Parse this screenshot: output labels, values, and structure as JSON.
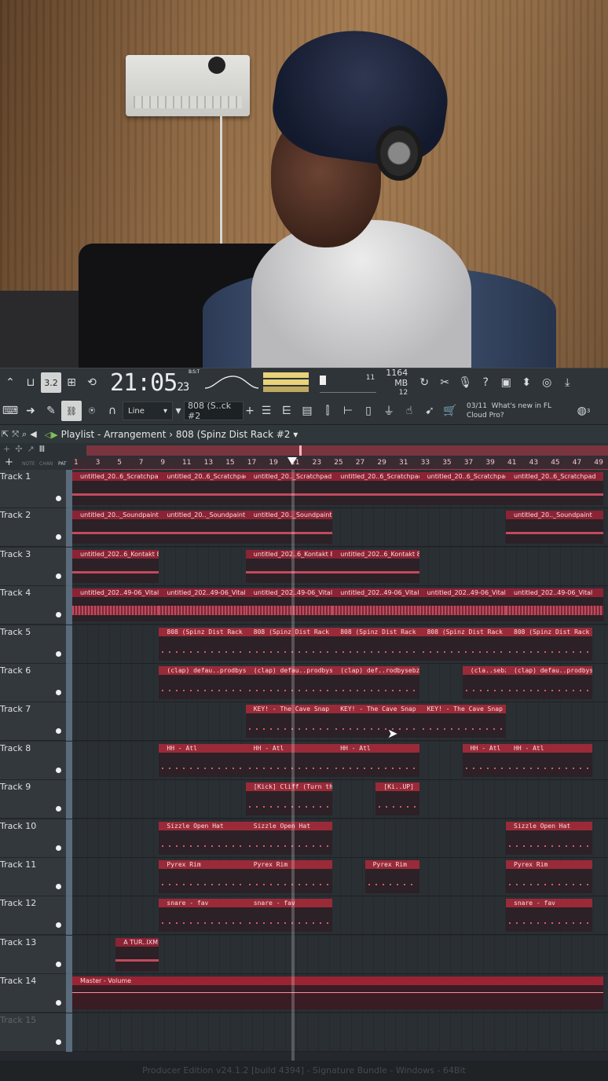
{
  "toolbar": {
    "tempo_display": "3.2",
    "clock": "21:05",
    "clock_small": "23",
    "clock_sup": "B:S:T",
    "cpu_value": "11",
    "memory_mb": "1164 MB",
    "polyphony": "12",
    "snap_mode": "Line",
    "pattern_name": "808 (S..ck #2",
    "news_date": "03/11",
    "news_text": "What's new in FL",
    "news_text2": "Cloud Pro?",
    "news_badge": "3"
  },
  "playlist": {
    "title": "Playlist - Arrangement",
    "separator": "›",
    "pattern": "808 (Spinz Dist Rack #2",
    "dropdown_arrow": "▾"
  },
  "ruler": {
    "bars": [
      "1",
      "3",
      "5",
      "7",
      "9",
      "11",
      "13",
      "15",
      "17",
      "19",
      "21",
      "23",
      "25",
      "27",
      "29",
      "31",
      "33",
      "35",
      "37",
      "39",
      "41",
      "43",
      "45",
      "47",
      "49"
    ],
    "left_labels": [
      "NOTE",
      "CHAN",
      "PAT"
    ]
  },
  "tracks": [
    {
      "name": "Track 1"
    },
    {
      "name": "Track 2"
    },
    {
      "name": "Track 3"
    },
    {
      "name": "Track 4"
    },
    {
      "name": "Track 5"
    },
    {
      "name": "Track 6"
    },
    {
      "name": "Track 7"
    },
    {
      "name": "Track 8"
    },
    {
      "name": "Track 9"
    },
    {
      "name": "Track 10"
    },
    {
      "name": "Track 11"
    },
    {
      "name": "Track 12"
    },
    {
      "name": "Track 13"
    },
    {
      "name": "Track 14"
    },
    {
      "name": "Track 15"
    }
  ],
  "clips": {
    "t1": [
      "untitled_20..6_Scratchpad",
      "untitled_20..6_Scratchpad",
      "untitled_20.._Scratchpad",
      "untitled_20..6_Scratchpad",
      "untitled_20..6_Scratchpad",
      "untitled_20..6_Scratchpad"
    ],
    "t2": [
      "untitled_20.._Soundpaint",
      "untitled_20.._Soundpaint",
      "untitled_20.._Soundpaint",
      "untitled_20.._Soundpaint"
    ],
    "t3": [
      "untitled_202..6_Kontakt 8",
      "untitled_202..6_Kontakt 8",
      "untitled_202..6_Kontakt 8"
    ],
    "t4": [
      "untitled_202..49-06_Vital",
      "untitled_202..49-06_Vital",
      "untitled_202..49-06_Vital",
      "untitled_202..49-06_Vital",
      "untitled_202..49-06_Vital",
      "untitled_202..49-06_Vital"
    ],
    "t5": [
      "808 (Spinz Dist Rack #2",
      "808 (Spinz Dist Rack",
      "808 (Spinz Dist Rack",
      "808 (Spinz Dist Rack",
      "808 (Spinz Dist Rack"
    ],
    "t6": [
      "(clap) defau..prodbysebzy",
      "(clap) defau..prodbysebzy",
      "(clap) def..rodbysebzy",
      "(cla..sebzy",
      "(clap) defau..prodbysebzy"
    ],
    "t7": [
      "KEY! - The Cave Snap",
      "KEY! - The Cave Snap",
      "KEY! - The Cave Snap"
    ],
    "t8": [
      "HH - Atl",
      "HH - Atl",
      "HH - Atl",
      "HH - Atl",
      "HH - Atl"
    ],
    "t9": [
      "[Kick] Cliff (Turn this UP)",
      "[Ki..UP]"
    ],
    "t10": [
      "Sizzle Open Hat",
      "Sizzle Open Hat",
      "Sizzle Open Hat"
    ],
    "t11": [
      "Pyrex Rim",
      "Pyrex Rim",
      "Pyrex Rim",
      "Pyrex Rim"
    ],
    "t12": [
      "snare - fav",
      "snare - fav",
      "snare - fav"
    ],
    "t13": [
      "A TUR..IXM"
    ],
    "t14": [
      "Master - Volume"
    ]
  },
  "status": "Producer Edition v24.1.2 [build 4394] - Signature Bundle - Windows - 64Bit",
  "colors": {
    "clip_header": "#8c2334",
    "scrollbar": "#7a3440",
    "toolbar_bg": "#2e3438",
    "playlist_bg": "#25292d"
  }
}
